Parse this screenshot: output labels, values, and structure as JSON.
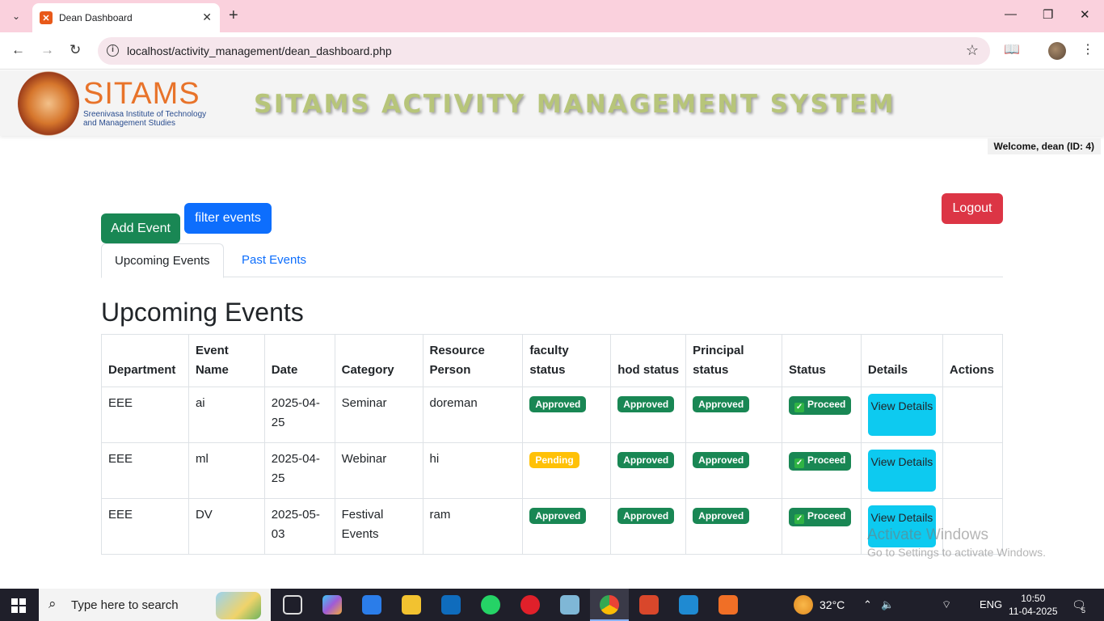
{
  "browser": {
    "tab_title": "Dean Dashboard",
    "url": "localhost/activity_management/dean_dashboard.php"
  },
  "header": {
    "brand": "SITAMS",
    "brand_sub_line1": "Sreenivasa Institute of Technology",
    "brand_sub_line2": "and Management Studies",
    "system_title": "SITAMS ACTIVITY MANAGEMENT SYSTEM",
    "welcome": "Welcome, dean (ID: 4)"
  },
  "actions": {
    "add_event": "Add Event",
    "filter_events": "filter events",
    "logout": "Logout"
  },
  "tabs": [
    {
      "label": "Upcoming Events",
      "active": true
    },
    {
      "label": "Past Events",
      "active": false
    }
  ],
  "section_title": "Upcoming Events",
  "table": {
    "headers": [
      "Department",
      "Event Name",
      "Date",
      "Category",
      "Resource Person",
      "faculty status",
      "hod status",
      "Principal status",
      "Status",
      "Details",
      "Actions"
    ],
    "rows": [
      {
        "department": "EEE",
        "event_name": "ai",
        "date": "2025-04-25",
        "category": "Seminar",
        "resource_person": "doreman",
        "faculty_status": "Approved",
        "hod_status": "Approved",
        "principal_status": "Approved",
        "status": "Proceed",
        "details": "View Details"
      },
      {
        "department": "EEE",
        "event_name": "ml",
        "date": "2025-04-25",
        "category": "Webinar",
        "resource_person": "hi",
        "faculty_status": "Pending",
        "hod_status": "Approved",
        "principal_status": "Approved",
        "status": "Proceed",
        "details": "View Details"
      },
      {
        "department": "EEE",
        "event_name": "DV",
        "date": "2025-05-03",
        "category": "Festival Events",
        "resource_person": "ram",
        "faculty_status": "Approved",
        "hod_status": "Approved",
        "principal_status": "Approved",
        "status": "Proceed",
        "details": "View Details"
      }
    ]
  },
  "watermark": {
    "line1": "Activate Windows",
    "line2": "Go to Settings to activate Windows."
  },
  "taskbar": {
    "search_placeholder": "Type here to search",
    "weather": "32°C",
    "language": "ENG",
    "time": "10:50",
    "date": "11-04-2025",
    "notification_count": "5"
  },
  "colors": {
    "success": "#198754",
    "warning": "#ffc107",
    "primary": "#0d6efd",
    "danger": "#dc3545",
    "info": "#0dcaf0"
  }
}
